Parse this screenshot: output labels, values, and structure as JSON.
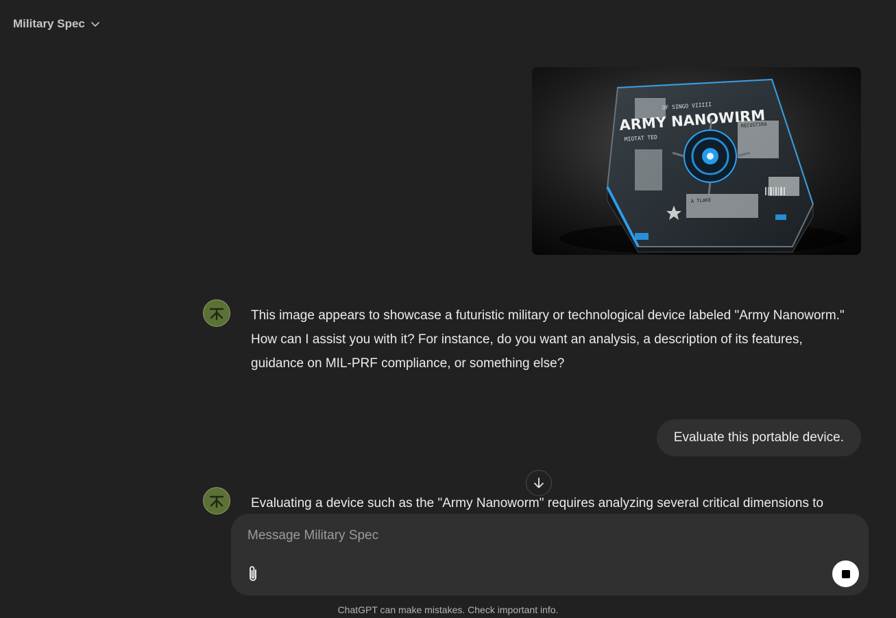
{
  "header": {
    "title": "Military Spec"
  },
  "image_labels": {
    "main": "ARMY NANOWIRM",
    "top": "OF SINGO VIIIII",
    "left": "MIOTAT TED",
    "right": "RECUSTIRA",
    "bottom": "A TLAKE"
  },
  "messages": {
    "assistant_1": "This image appears to showcase a futuristic military or technological device labeled \"Army Nanoworm.\" How can I assist you with it? For instance, do you want an analysis, a description of its features, guidance on MIL-PRF compliance, or something else?",
    "user_2": "Evaluate this portable device.",
    "assistant_2": "Evaluating a device such as the \"Army Nanoworm\" requires analyzing several critical dimensions to"
  },
  "composer": {
    "placeholder": "Message Military Spec"
  },
  "footer": {
    "disclaimer": "ChatGPT can make mistakes. Check important info."
  },
  "colors": {
    "background": "#212121",
    "bubble": "#303030",
    "avatar": "#5c7135",
    "glow": "#29a8ff"
  }
}
